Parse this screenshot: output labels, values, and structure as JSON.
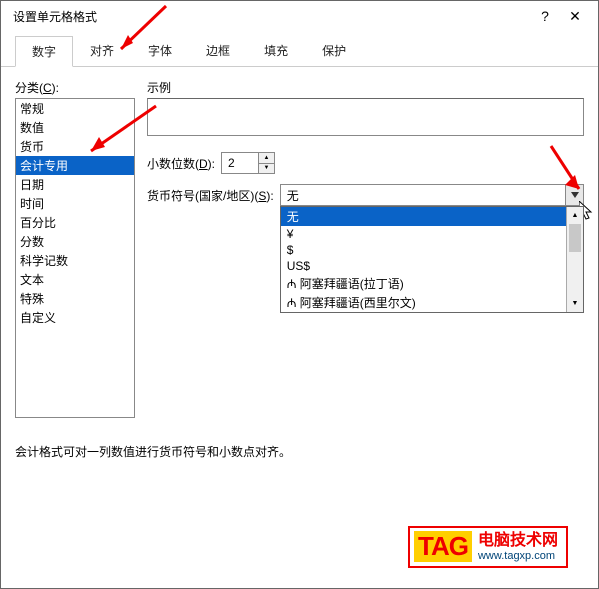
{
  "title": "设置单元格格式",
  "help_glyph": "?",
  "close_glyph": "✕",
  "tabs": [
    "数字",
    "对齐",
    "字体",
    "边框",
    "填充",
    "保护"
  ],
  "active_tab_index": 0,
  "category_label_prefix": "分类(",
  "category_hotkey": "C",
  "category_label_suffix": "):",
  "categories": [
    "常规",
    "数值",
    "货币",
    "会计专用",
    "日期",
    "时间",
    "百分比",
    "分数",
    "科学记数",
    "文本",
    "特殊",
    "自定义"
  ],
  "selected_category_index": 3,
  "sample_label": "示例",
  "decimal_label_prefix": "小数位数(",
  "decimal_hotkey": "D",
  "decimal_label_suffix": "):",
  "decimal_value": "2",
  "symbol_label_prefix": "货币符号(国家/地区)(",
  "symbol_hotkey": "S",
  "symbol_label_suffix": "):",
  "symbol_value": "无",
  "symbol_options": [
    "无",
    "¥",
    "$",
    "US$",
    "₼ 阿塞拜疆语(拉丁语)",
    "₼ 阿塞拜疆语(西里尔文)"
  ],
  "symbol_selected_index": 0,
  "description": "会计格式可对一列数值进行货币符号和小数点对齐。",
  "tag": {
    "label": "TAG",
    "line1": "电脑技术网",
    "line2": "www.tagxp.com"
  }
}
